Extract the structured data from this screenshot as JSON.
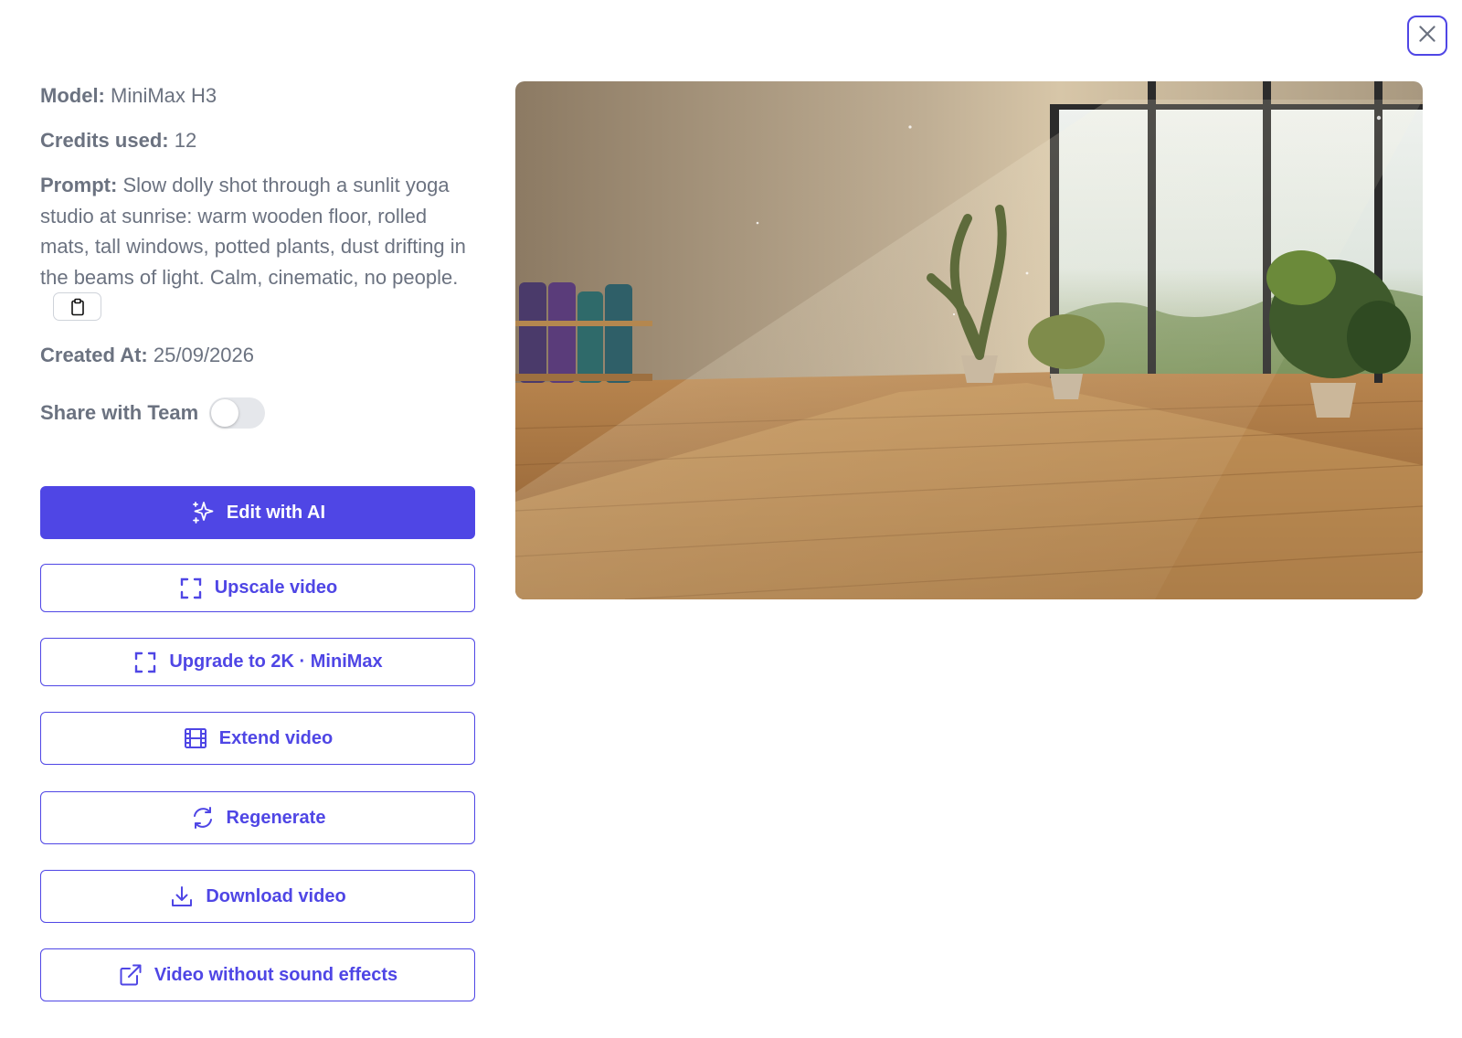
{
  "dialog": {
    "close_icon": "close-icon"
  },
  "details": {
    "model_label": "Model:",
    "model_value": "MiniMax H3",
    "credits_label": "Credits used:",
    "credits_value": "12",
    "prompt_label": "Prompt:",
    "prompt_value": "Slow dolly shot through a sunlit yoga studio at sunrise: warm wooden floor, rolled mats, tall windows, potted plants, dust drifting in the beams of light. Calm, cinematic, no people.",
    "copy_icon": "clipboard-icon",
    "created_label": "Created At:",
    "created_value": "25/09/2026"
  },
  "share": {
    "label": "Share with Team",
    "enabled": false
  },
  "actions": {
    "edit_ai": {
      "label": "Edit with AI",
      "icon": "sparkles-icon"
    },
    "upscale": {
      "label": "Upscale video",
      "icon": "expand-icon"
    },
    "upgrade": {
      "label": "Upgrade to 2K · MiniMax",
      "icon": "expand-icon"
    },
    "extend": {
      "label": "Extend video",
      "icon": "film-icon"
    },
    "regenerate": {
      "label": "Regenerate",
      "icon": "refresh-icon"
    },
    "download": {
      "label": "Download video",
      "icon": "download-icon"
    },
    "no_sound": {
      "label": "Video without sound effects",
      "icon": "external-link-icon"
    }
  },
  "colors": {
    "accent": "#4f46e5",
    "text": "#6b7280",
    "toggle_off": "#e5e7eb"
  }
}
